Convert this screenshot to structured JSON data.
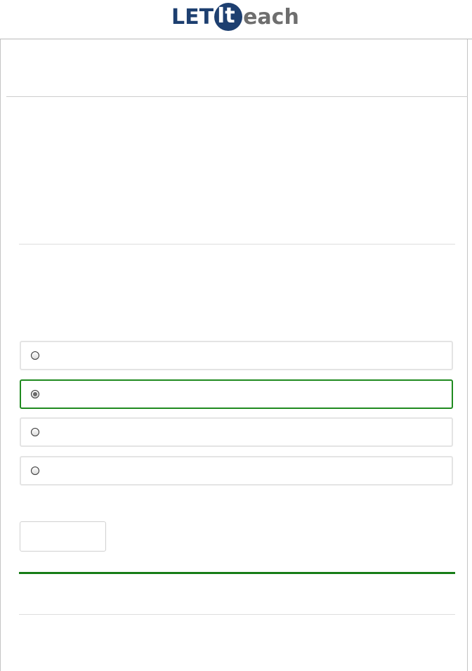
{
  "header": {
    "logo": {
      "part1": "LET",
      "part2": "It",
      "part3": "each"
    },
    "colors": {
      "brand_dark": "#1d3f70",
      "brand_gray": "#6e6e6e"
    }
  },
  "quiz": {
    "options": [
      {
        "label": "",
        "selected": false
      },
      {
        "label": "",
        "selected": true
      },
      {
        "label": "",
        "selected": false
      },
      {
        "label": "",
        "selected": false
      }
    ],
    "submit_label": "",
    "colors": {
      "correct": "#1f8a1f"
    }
  }
}
